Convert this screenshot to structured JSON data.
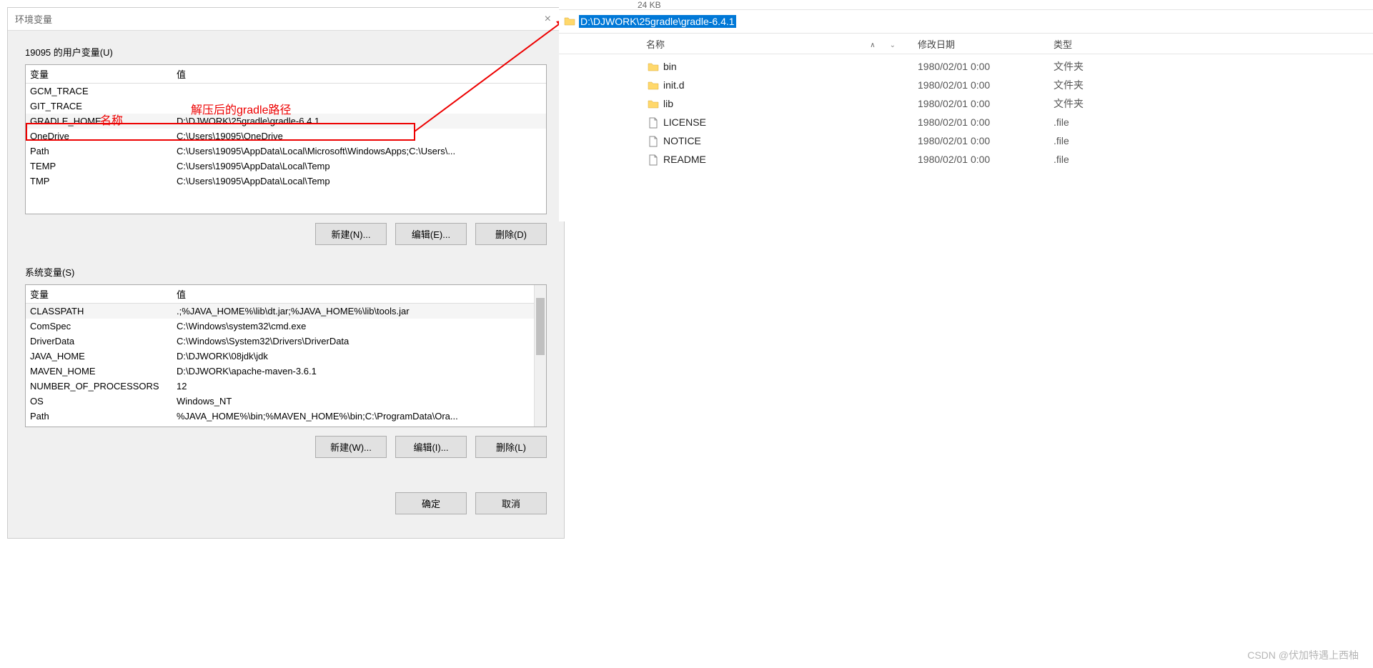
{
  "dialog": {
    "title": "环境变量",
    "user_section_label": "19095 的用户变量(U)",
    "sys_section_label": "系统变量(S)",
    "col_var": "变量",
    "col_val": "值",
    "user_vars": [
      {
        "name": "GCM_TRACE",
        "value": ""
      },
      {
        "name": "GIT_TRACE",
        "value": ""
      },
      {
        "name": "GRADLE_HOME",
        "value": "D:\\DJWORK\\25gradle\\gradle-6.4.1"
      },
      {
        "name": "OneDrive",
        "value": "C:\\Users\\19095\\OneDrive"
      },
      {
        "name": "Path",
        "value": "C:\\Users\\19095\\AppData\\Local\\Microsoft\\WindowsApps;C:\\Users\\..."
      },
      {
        "name": "TEMP",
        "value": "C:\\Users\\19095\\AppData\\Local\\Temp"
      },
      {
        "name": "TMP",
        "value": "C:\\Users\\19095\\AppData\\Local\\Temp"
      }
    ],
    "sys_vars": [
      {
        "name": "CLASSPATH",
        "value": ".;%JAVA_HOME%\\lib\\dt.jar;%JAVA_HOME%\\lib\\tools.jar"
      },
      {
        "name": "ComSpec",
        "value": "C:\\Windows\\system32\\cmd.exe"
      },
      {
        "name": "DriverData",
        "value": "C:\\Windows\\System32\\Drivers\\DriverData"
      },
      {
        "name": "JAVA_HOME",
        "value": "D:\\DJWORK\\08jdk\\jdk"
      },
      {
        "name": "MAVEN_HOME",
        "value": "D:\\DJWORK\\apache-maven-3.6.1"
      },
      {
        "name": "NUMBER_OF_PROCESSORS",
        "value": "12"
      },
      {
        "name": "OS",
        "value": "Windows_NT"
      },
      {
        "name": "Path",
        "value": "%JAVA_HOME%\\bin;%MAVEN_HOME%\\bin;C:\\ProgramData\\Ora..."
      }
    ],
    "btn_new_n": "新建(N)...",
    "btn_edit_e": "编辑(E)...",
    "btn_del_d": "删除(D)",
    "btn_new_w": "新建(W)...",
    "btn_edit_i": "编辑(I)...",
    "btn_del_l": "删除(L)",
    "btn_ok": "确定",
    "btn_cancel": "取消"
  },
  "annotations": {
    "name_label": "名称",
    "path_label": "解压后的gradle路径"
  },
  "explorer": {
    "size_text": "24 KB",
    "address": "D:\\DJWORK\\25gradle\\gradle-6.4.1",
    "col_name": "名称",
    "col_date": "修改日期",
    "col_type": "类型",
    "rows": [
      {
        "icon": "folder",
        "name": "bin",
        "date": "1980/02/01 0:00",
        "type": "文件夹"
      },
      {
        "icon": "folder",
        "name": "init.d",
        "date": "1980/02/01 0:00",
        "type": "文件夹"
      },
      {
        "icon": "folder",
        "name": "lib",
        "date": "1980/02/01 0:00",
        "type": "文件夹"
      },
      {
        "icon": "file",
        "name": "LICENSE",
        "date": "1980/02/01 0:00",
        "type": ".file"
      },
      {
        "icon": "file",
        "name": "NOTICE",
        "date": "1980/02/01 0:00",
        "type": ".file"
      },
      {
        "icon": "file",
        "name": "README",
        "date": "1980/02/01 0:00",
        "type": ".file"
      }
    ]
  },
  "watermark": "CSDN @伏加特遇上西柚"
}
